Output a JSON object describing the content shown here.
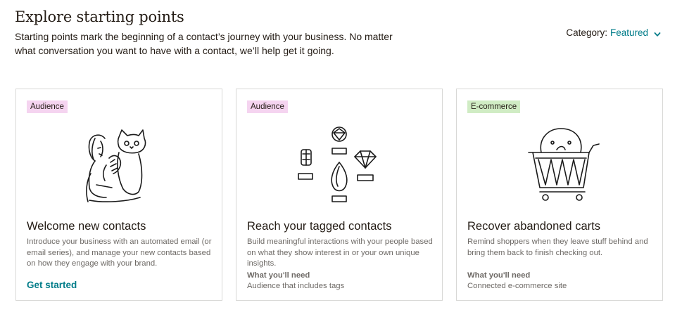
{
  "header": {
    "title": "Explore starting points",
    "description": "Starting points mark the beginning of a contact’s journey with your business. No matter what conversation you want to have with a contact, we’ll help get it going.",
    "category_label": "Category:",
    "category_value": "Featured"
  },
  "cards": [
    {
      "badge": "Audience",
      "title": "Welcome new contacts",
      "description": "Introduce your business with an automated email (or email series), and manage your new contacts based on how they engage with your brand.",
      "cta": "Get started"
    },
    {
      "badge": "Audience",
      "title": "Reach your tagged contacts",
      "description": "Build meaningful interactions with your people based on what they show interest in or your own unique insights.",
      "need_label": "What you'll need",
      "need_value": "Audience that includes tags"
    },
    {
      "badge": "E-commerce",
      "title": "Recover abandoned carts",
      "description": "Remind shoppers when they leave stuff behind and bring them back to finish checking out.",
      "need_label": "What you'll need",
      "need_value": "Connected e-commerce site"
    }
  ],
  "icons": {
    "category_chevron": "chevron-down-icon",
    "card1_illustration": "woman-and-cat-illustration",
    "card2_illustration": "gems-and-tags-illustration",
    "card3_illustration": "shopping-cart-character-illustration"
  },
  "colors": {
    "accent": "#007c89",
    "audience_badge": "#f5d4f0",
    "ecommerce_badge": "#d0ecc4",
    "text": "#241c15",
    "muted": "#6e6a66",
    "border": "#d8d8d6"
  }
}
